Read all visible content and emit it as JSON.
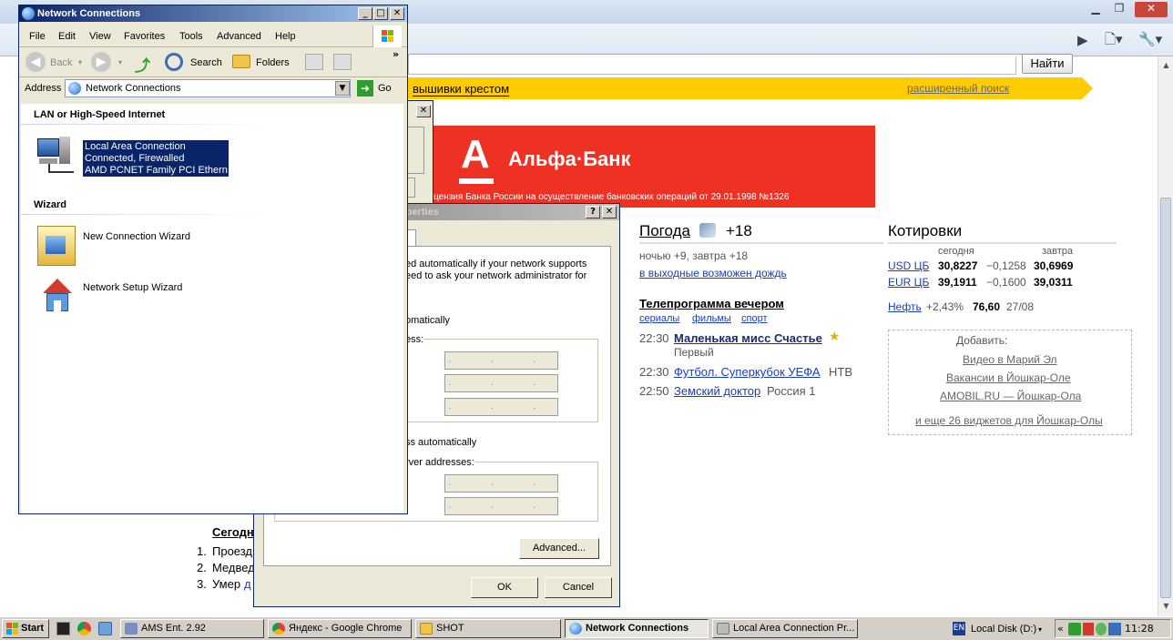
{
  "network_connections": {
    "title": "Network Connections",
    "menu": [
      "File",
      "Edit",
      "View",
      "Favorites",
      "Tools",
      "Advanced",
      "Help"
    ],
    "toolbar": {
      "back": "Back",
      "search": "Search",
      "folders": "Folders"
    },
    "address_label": "Address",
    "address_value": "Network Connections",
    "go_label": "Go",
    "sections": {
      "lan": "LAN or High-Speed Internet",
      "wizard": "Wizard"
    },
    "lan_item": [
      "Local Area Connection",
      "Connected, Firewalled",
      "AMD PCNET Family PCI Ethern..."
    ],
    "wizards": [
      "New Connection Wizard",
      "Network Setup Wizard"
    ]
  },
  "tcpip_dialog": {
    "title_fragment": "operties",
    "text_lines": [
      "ed automatically if your network supports",
      "eed to ask your network administrator for"
    ],
    "obtain_ip": "omatically",
    "ip_label": "ess:",
    "obtain_dns": "ss automatically",
    "dns_label": "rver addresses:",
    "advanced": "Advanced...",
    "ok": "OK",
    "cancel": "Cancel",
    "ip_placeholder": ". . ."
  },
  "browser": {
    "search_button": "Найти",
    "promo_link": "вышивки крестом",
    "advanced_search": "расширенный поиск",
    "bank_name": "Альфа·Банк",
    "bank_logo_letter": "А",
    "bank_license": "цензия Банка России на осуществление банковских операций от 29.01.1998 №1326",
    "weather": {
      "title": "Погода",
      "temp": "+18",
      "forecast": "ночью +9,  завтра +18",
      "note": "в выходные возможен дождь"
    },
    "tv": {
      "title": "Телепрограмма вечером",
      "tabs": [
        "сериалы",
        "фильмы",
        "спорт"
      ],
      "items": [
        {
          "time": "22:30",
          "show": "Маленькая мисс Счастье",
          "channel": "Первый"
        },
        {
          "time": "22:30",
          "show": "Футбол. Суперкубок УЕФА",
          "channel": "НТВ"
        },
        {
          "time": "22:50",
          "show": "Земский доктор",
          "channel": "Россия 1"
        }
      ]
    },
    "quotes": {
      "title": "Котировки",
      "today": "сегодня",
      "tomorrow": "завтра",
      "rows": [
        {
          "name": "USD ЦБ",
          "value": "30,8227",
          "change": "−0,1258",
          "tomorrow": "30,6969"
        },
        {
          "name": "EUR ЦБ",
          "value": "39,1911",
          "change": "−0,1600",
          "tomorrow": "39,0311"
        }
      ],
      "oil": {
        "name": "Нефть",
        "change": "+2,43%",
        "value": "76,60",
        "date": "27/08"
      }
    },
    "add_widgets": {
      "title": "Добавить:",
      "links": [
        "Видео в Марий Эл",
        "Вакансии в Йошкар-Оле",
        "AMOBIL.RU — Йошкар-Ола",
        "и еще 26 виджетов для Йошкар-Олы"
      ]
    },
    "news": {
      "title": "Сегодн",
      "items": [
        "Проезд",
        "Медвед",
        "Умер"
      ],
      "numbers": [
        "1.",
        "2.",
        "3."
      ],
      "link_fragment": "д"
    }
  },
  "taskbar": {
    "start": "Start",
    "tasks": [
      "AMS Ent. 2.92",
      "Яндекс - Google Chrome",
      "SHOT",
      "Network Connections",
      "Local Area Connection Pr..."
    ],
    "lang": "EN",
    "disk": "Local Disk (D:)",
    "tray_chevron": "«",
    "time": "11:28"
  }
}
